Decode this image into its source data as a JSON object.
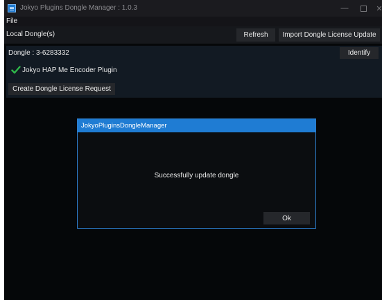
{
  "window": {
    "title": "Jokyo Plugins Dongle Manager : 1.0.3",
    "controls": {
      "minimize": "—",
      "close": "✕"
    }
  },
  "menu": {
    "file": "File"
  },
  "toolbar": {
    "local_label": "Local Dongle(s)",
    "refresh_label": "Refresh",
    "import_label": "Import Dongle License Update"
  },
  "dongle": {
    "label": "Dongle : 3-6283332",
    "identify_label": "Identify",
    "plugins": [
      {
        "name": "Jokyo HAP Me Encoder Plugin",
        "status_icon": "check-icon"
      }
    ],
    "create_request_label": "Create Dongle License Request"
  },
  "dialog": {
    "title": "JokyoPluginsDongleManager",
    "message": "Successfully update dongle",
    "ok_label": "Ok"
  },
  "colors": {
    "accent": "#1f7cd3",
    "check": "#2fb84a",
    "background": "#050709"
  }
}
